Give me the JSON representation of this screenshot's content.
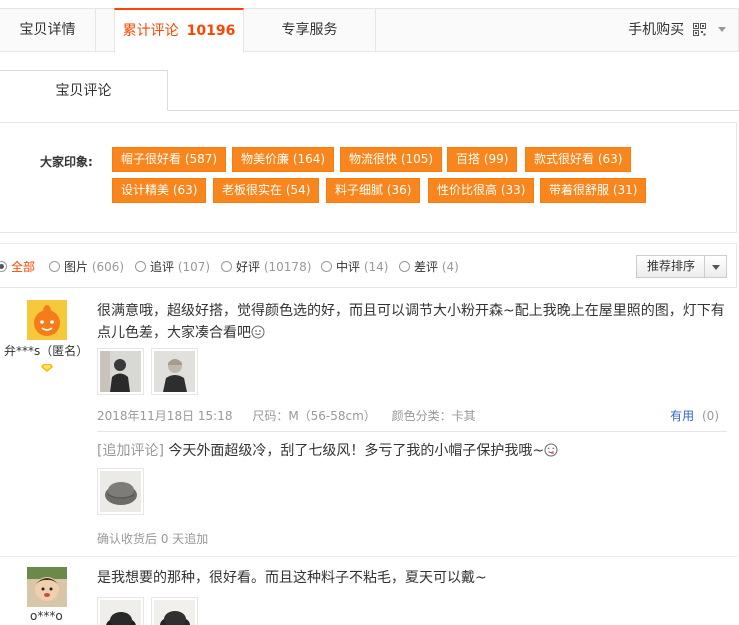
{
  "tabs": {
    "detail": "宝贝详情",
    "reviews": "累计评论",
    "reviews_count": "10196",
    "service": "专享服务",
    "mobile": "手机购买"
  },
  "subtab": "宝贝评论",
  "impressions": {
    "label": "大家印象:",
    "tags": [
      "帽子很好看 (587)",
      "物美价廉 (164)",
      "物流很快 (105)",
      "百搭 (99)",
      "款式很好看 (63)",
      "设计精美 (63)",
      "老板很实在 (54)",
      "料子细腻 (36)",
      "性价比很高 (33)",
      "带着很舒服 (31)"
    ]
  },
  "filters": {
    "all": "全部",
    "pics": "图片",
    "pics_count": "(606)",
    "append": "追评",
    "append_count": "(107)",
    "good": "好评",
    "good_count": "(10178)",
    "mid": "中评",
    "mid_count": "(14)",
    "bad": "差评",
    "bad_count": "(4)",
    "sort": "推荐排序"
  },
  "reviews": [
    {
      "user": "弁***s（匿名）",
      "text": "很满意哦，超级好搭，觉得颜色选的好，而且可以调节大小粉开森~配上我晚上在屋里照的图，灯下有点儿色差，大家凑合看吧",
      "date": "2018年11月18日 15:18",
      "size": "尺码：M（56-58cm）",
      "color": "颜色分类：卡其",
      "useful_label": "有用",
      "useful_count": "(0)",
      "append_tag": "[追加评论]",
      "append_text": "今天外面超级冷，刮了七级风！多亏了我的小帽子保护我哦~",
      "append_meta": "确认收货后 0 天追加"
    },
    {
      "user": "o***o",
      "text": "是我想要的那种，很好看。而且这种料子不粘毛，夏天可以戴~"
    }
  ],
  "colors": {
    "accent": "#ff4400",
    "tag_bg": "#f9861d",
    "link": "#3366cc"
  }
}
